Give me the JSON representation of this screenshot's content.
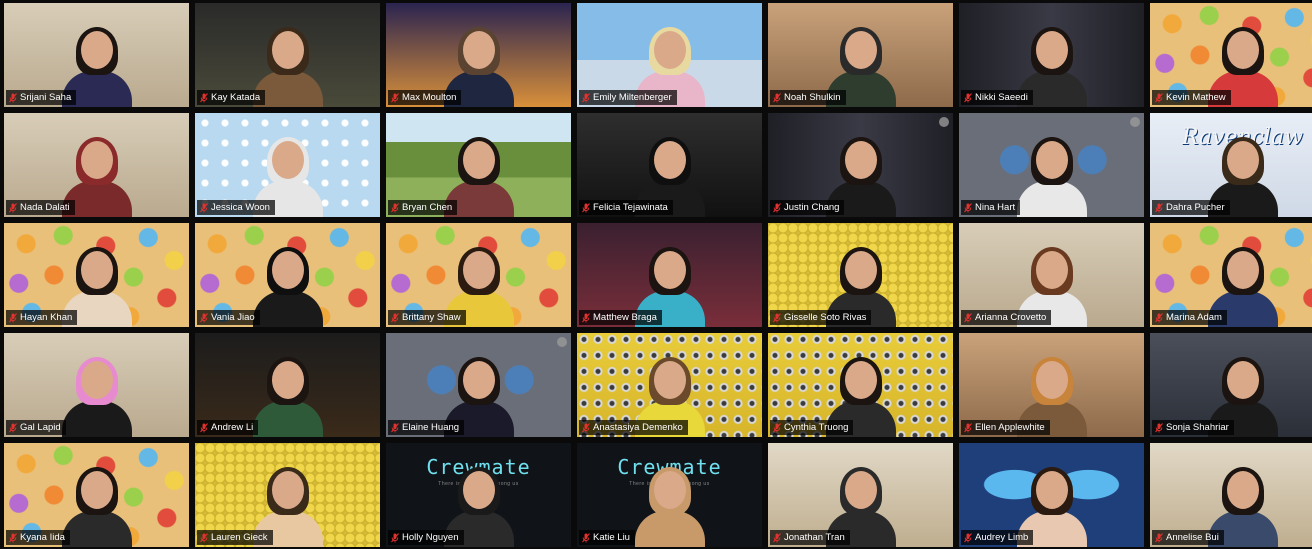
{
  "gallery": {
    "participants": [
      {
        "name": "Srijani Saha",
        "bg": "room",
        "hair": "#1b1410",
        "shirt": "#2a2a55"
      },
      {
        "name": "Kay Katada",
        "bg": "plush",
        "hair": "#3b2a1a",
        "shirt": "#7a5a3a"
      },
      {
        "name": "Max Moulton",
        "bg": "city",
        "hair": "#5a4330",
        "shirt": "#1f2640"
      },
      {
        "name": "Emily Miltenberger",
        "bg": "castle",
        "hair": "#e8d9a0",
        "shirt": "#e8b6c8"
      },
      {
        "name": "Noah Shulkin",
        "bg": "warm",
        "hair": "#2a2a2a",
        "shirt": "#2f3d2f"
      },
      {
        "name": "Nikki Saeedi",
        "bg": "formal",
        "hair": "#1b1410",
        "shirt": "#2a2a2a"
      },
      {
        "name": "Kevin Mathew",
        "bg": "cereal",
        "hair": "#1b1410",
        "shirt": "#d63a3a"
      },
      {
        "name": "Nada Dalati",
        "bg": "room",
        "hair": "#8a2a2a",
        "shirt": "#7a2a2a"
      },
      {
        "name": "Jessica Woon",
        "bg": "bunny",
        "hair": "#e6e6e6",
        "shirt": "#e6e6e6"
      },
      {
        "name": "Bryan Chen",
        "bg": "farm",
        "hair": "#1b1410",
        "shirt": "#7a3a3a"
      },
      {
        "name": "Felicia Tejawinata",
        "bg": "dark",
        "hair": "#0f0f0f",
        "shirt": "#1a1a1a"
      },
      {
        "name": "Justin Chang",
        "bg": "formal",
        "hair": "#1b1410",
        "shirt": "#1a1a1a"
      },
      {
        "name": "Nina Hart",
        "bg": "amongus",
        "hair": "#1b1410",
        "shirt": "#e8e8e8"
      },
      {
        "name": "Dahra Pucher",
        "bg": "ravenclaw",
        "hair": "#3a2a1a",
        "shirt": "#1a1a1a",
        "banner": "Ravenclaw"
      },
      {
        "name": "Hayan Khan",
        "bg": "cereal",
        "hair": "#1b1410",
        "shirt": "#e8d6c0"
      },
      {
        "name": "Vania Jiao",
        "bg": "cereal",
        "hair": "#0f0f0f",
        "shirt": "#1a1a1a"
      },
      {
        "name": "Brittany Shaw",
        "bg": "cereal",
        "hair": "#2a1a10",
        "shirt": "#e8c83a"
      },
      {
        "name": "Matthew Braga",
        "bg": "tent",
        "hair": "#1b1410",
        "shirt": "#3ab0c8"
      },
      {
        "name": "Gisselle Soto Rivas",
        "bg": "ducks",
        "hair": "#1b1410",
        "shirt": "#2a2a2a"
      },
      {
        "name": "Arianna Crovetto",
        "bg": "room",
        "hair": "#6a3a20",
        "shirt": "#e8e8e8"
      },
      {
        "name": "Marina Adam",
        "bg": "cereal",
        "hair": "#1b1410",
        "shirt": "#2a3a6a"
      },
      {
        "name": "Gal Lapid",
        "bg": "room",
        "hair": "#e88ad0",
        "shirt": "#1a1a1a"
      },
      {
        "name": "Andrew Li",
        "bg": "basket",
        "hair": "#1b1410",
        "shirt": "#2f5a3a"
      },
      {
        "name": "Elaine Huang",
        "bg": "amongus",
        "hair": "#1b1410",
        "shirt": "#1a1a2a"
      },
      {
        "name": "Anastasiya Demenko",
        "bg": "minions",
        "hair": "#6a4a2a",
        "shirt": "#e8d83a"
      },
      {
        "name": "Cynthia Truong",
        "bg": "minions",
        "hair": "#1b1410",
        "shirt": "#2a2a2a"
      },
      {
        "name": "Ellen Applewhite",
        "bg": "warm",
        "hair": "#c8843a",
        "shirt": "#7a5a3a"
      },
      {
        "name": "Sonja Shahriar",
        "bg": "hogwarts",
        "hair": "#1b1410",
        "shirt": "#1a1a1a"
      },
      {
        "name": "Kyana Iida",
        "bg": "cereal",
        "hair": "#1b1410",
        "shirt": "#2a2a2a"
      },
      {
        "name": "Lauren Gieck",
        "bg": "ducks",
        "hair": "#3a2a1a",
        "shirt": "#e8c8a0"
      },
      {
        "name": "Holly Nguyen",
        "bg": "crewmate",
        "hair": "#1a1a1a",
        "shirt": "#2a2a2a",
        "crew": "Crewmate",
        "crew_sub": "There is 1 Impostor among us"
      },
      {
        "name": "Katie Liu",
        "bg": "crewmate",
        "hair": "#c89a6a",
        "shirt": "#c89a6a",
        "crew": "Crewmate",
        "crew_sub": "There is 1 Impostor among us"
      },
      {
        "name": "Jonathan Tran",
        "bg": "kitchen",
        "hair": "#2a2a2a",
        "shirt": "#2a2a2a"
      },
      {
        "name": "Audrey Limb",
        "bg": "fairy",
        "hair": "#2a1a10",
        "shirt": "#e8c8b0"
      },
      {
        "name": "Annelise Bui",
        "bg": "kitchen",
        "hair": "#1b1410",
        "shirt": "#3a4a6a"
      }
    ]
  },
  "colors": {
    "name_text": "#ffffff",
    "muted_mic": "#e0322e",
    "name_tag_bg": "rgba(0,0,0,0.72)"
  },
  "icons": {
    "muted": "mic-muted-icon"
  }
}
